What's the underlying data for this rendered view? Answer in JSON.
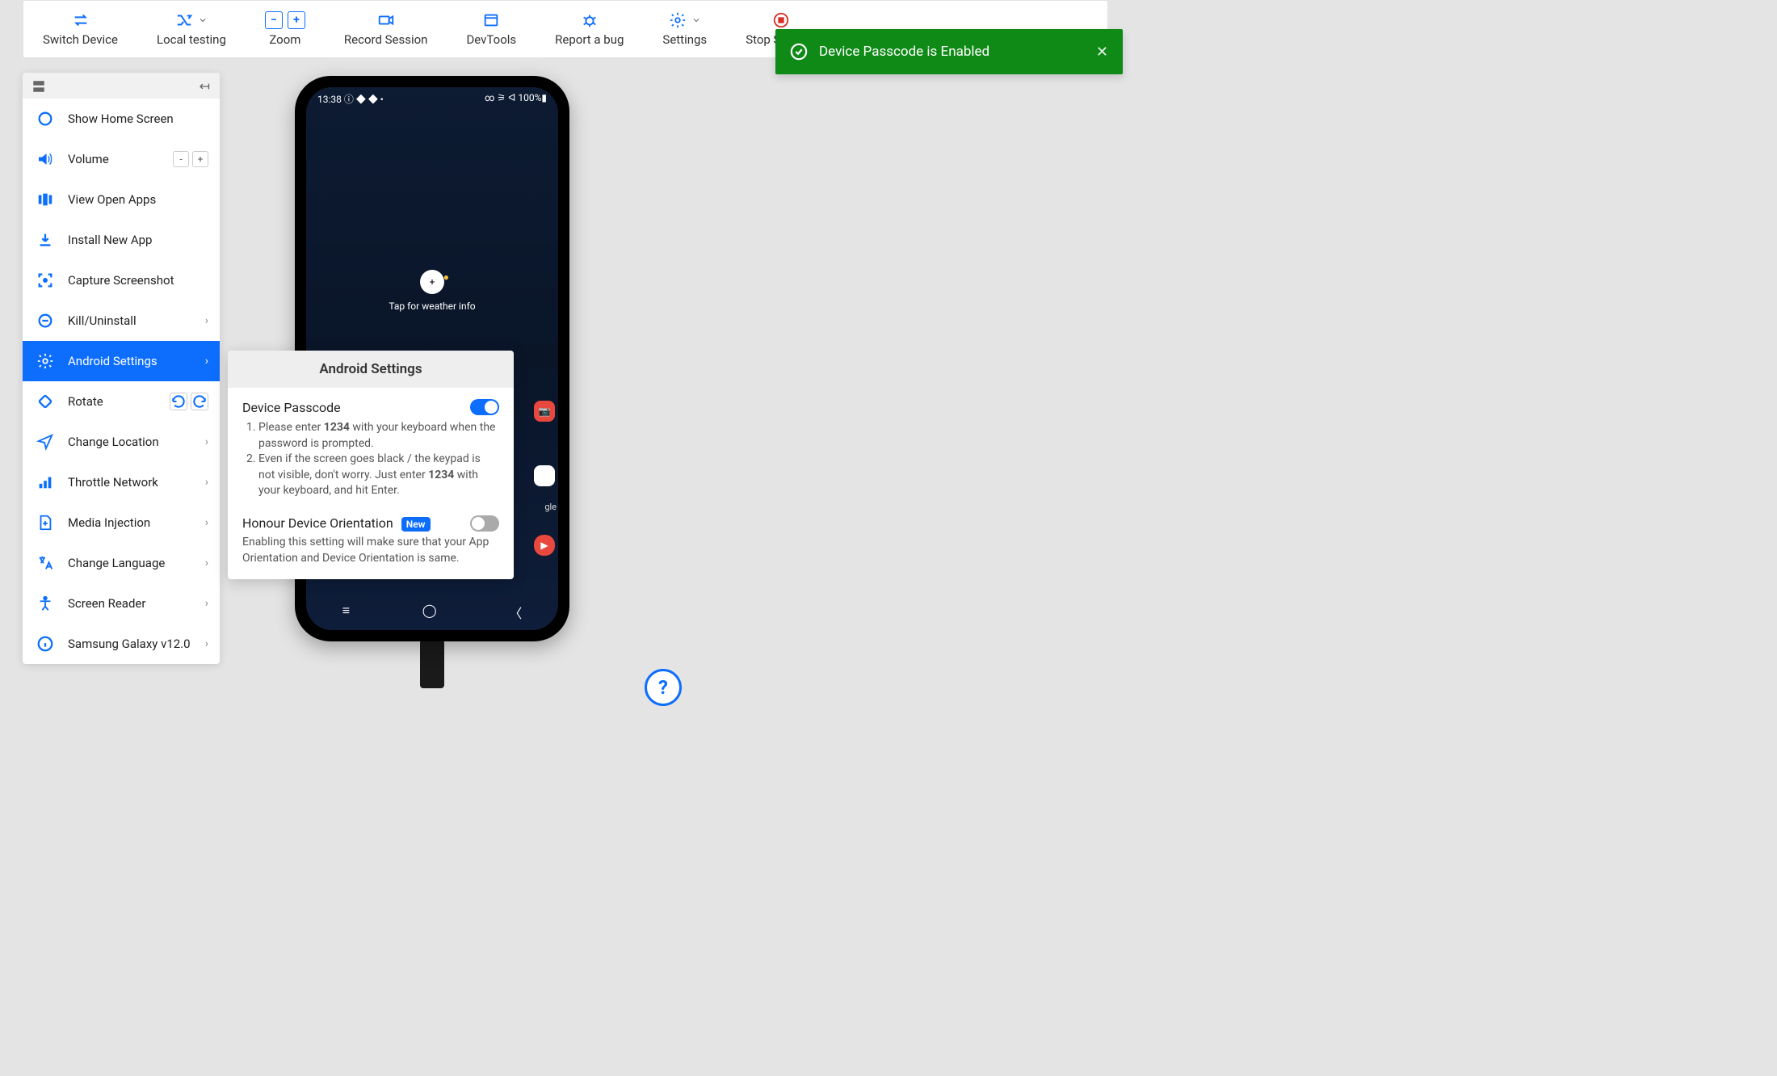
{
  "toolbar": {
    "switch_device": "Switch Device",
    "local_testing": "Local testing",
    "zoom": "Zoom",
    "record": "Record Session",
    "devtools": "DevTools",
    "report_bug": "Report a bug",
    "settings": "Settings",
    "stop": "Stop Session"
  },
  "toast": {
    "message": "Device Passcode is Enabled"
  },
  "sidebar": {
    "items": [
      {
        "label": "Show Home Screen"
      },
      {
        "label": "Volume"
      },
      {
        "label": "View Open Apps"
      },
      {
        "label": "Install New App"
      },
      {
        "label": "Capture Screenshot"
      },
      {
        "label": "Kill/Uninstall"
      },
      {
        "label": "Android Settings"
      },
      {
        "label": "Rotate"
      },
      {
        "label": "Change Location"
      },
      {
        "label": "Throttle Network"
      },
      {
        "label": "Media Injection"
      },
      {
        "label": "Change Language"
      },
      {
        "label": "Screen Reader"
      },
      {
        "label": "Samsung Galaxy  v12.0"
      }
    ]
  },
  "flyout": {
    "title": "Android Settings",
    "passcode": {
      "title": "Device Passcode",
      "enabled": true,
      "step1_a": "Please enter ",
      "step1_code": "1234",
      "step1_b": " with your keyboard when the password is prompted.",
      "step2_a": "Even if the screen goes black / the keypad is not visible, don't worry. Just enter ",
      "step2_code": "1234",
      "step2_b": " with your keyboard, and hit Enter."
    },
    "orientation": {
      "title": "Honour Device Orientation",
      "badge": "New",
      "desc": "Enabling this setting will make sure that your App Orientation and Device Orientation is same.",
      "enabled": false
    }
  },
  "phone": {
    "time": "13:38",
    "status_right": "100%",
    "weather_hint": "Tap for weather info",
    "google_label": "gle"
  },
  "help": {
    "symbol": "?"
  }
}
